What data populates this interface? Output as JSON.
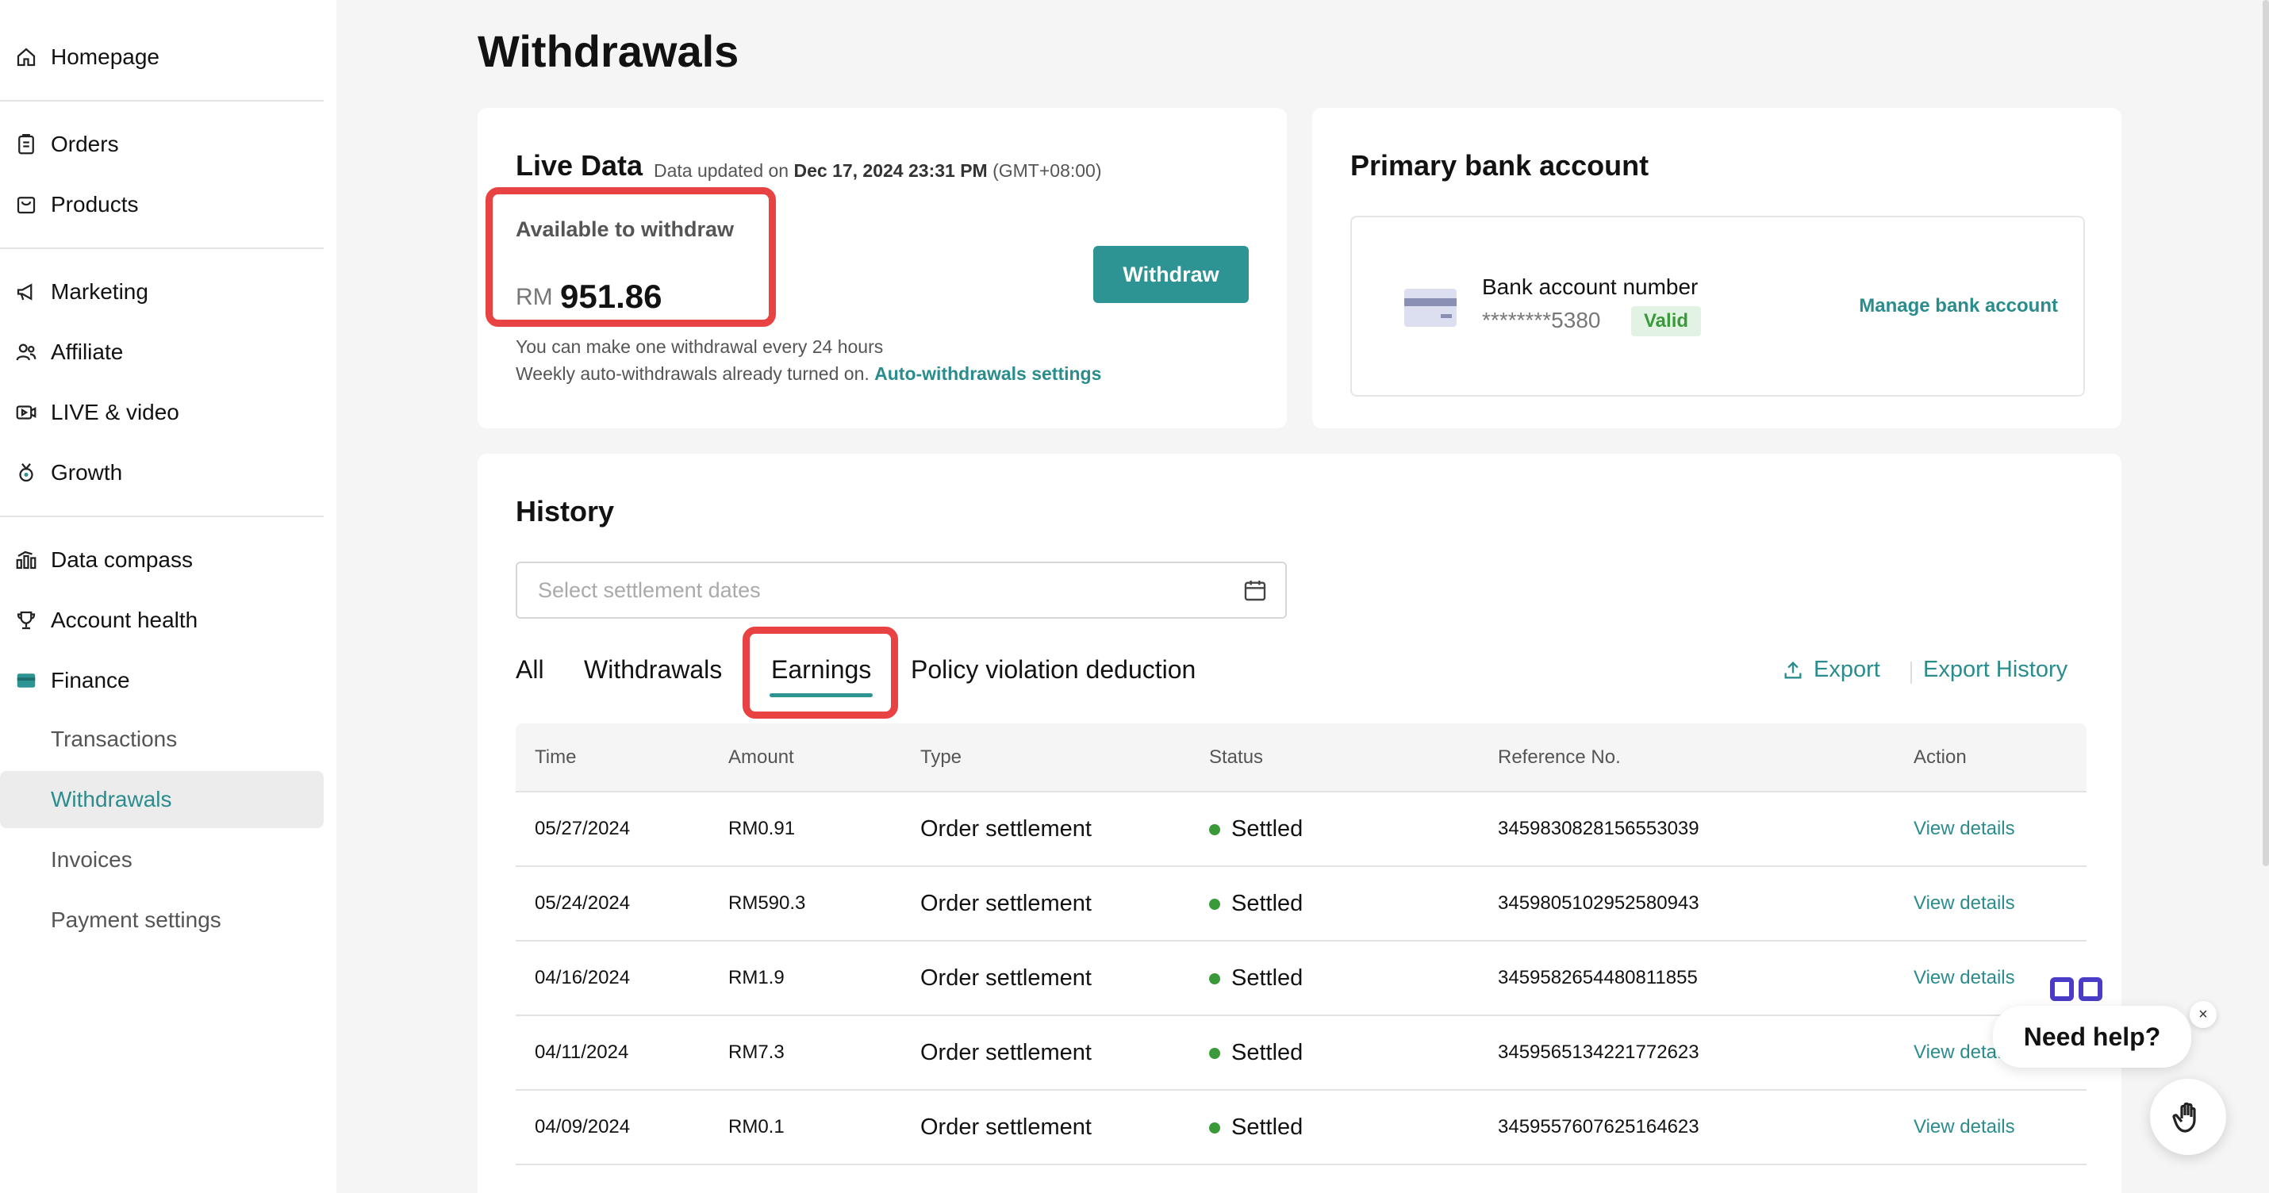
{
  "sidebar": {
    "items": [
      {
        "label": "Homepage",
        "icon": "home-icon"
      },
      {
        "label": "Orders",
        "icon": "clipboard-icon"
      },
      {
        "label": "Products",
        "icon": "bag-icon"
      },
      {
        "label": "Marketing",
        "icon": "megaphone-icon"
      },
      {
        "label": "Affiliate",
        "icon": "users-icon"
      },
      {
        "label": "LIVE & video",
        "icon": "video-icon"
      },
      {
        "label": "Growth",
        "icon": "medal-icon"
      },
      {
        "label": "Data compass",
        "icon": "bar-chart-icon"
      },
      {
        "label": "Account health",
        "icon": "trophy-icon"
      },
      {
        "label": "Finance",
        "icon": "wallet-icon"
      }
    ],
    "finance_sub": [
      {
        "label": "Transactions"
      },
      {
        "label": "Withdrawals"
      },
      {
        "label": "Invoices"
      },
      {
        "label": "Payment settings"
      }
    ]
  },
  "page": {
    "title": "Withdrawals"
  },
  "live": {
    "title": "Live Data",
    "updated_prefix": "Data updated on",
    "updated_date": "Dec 17, 2024 23:31 PM",
    "updated_tz": "(GMT+08:00)",
    "available_label": "Available to withdraw",
    "currency": "RM",
    "amount": "951.86",
    "withdraw_label": "Withdraw",
    "note1": "You can make one withdrawal every 24 hours",
    "note2": "Weekly auto-withdrawals already turned on.",
    "auto_link": "Auto-withdrawals settings"
  },
  "bank": {
    "title": "Primary bank account",
    "label": "Bank account number",
    "number": "********5380",
    "status": "Valid",
    "manage_link": "Manage bank account"
  },
  "history": {
    "title": "History",
    "date_placeholder": "Select settlement dates",
    "tabs": {
      "all": "All",
      "withdrawals": "Withdrawals",
      "earnings": "Earnings",
      "policy": "Policy violation deduction"
    },
    "export": "Export",
    "export_history": "Export History",
    "columns": [
      "Time",
      "Amount",
      "Type",
      "Status",
      "Reference No.",
      "Action"
    ],
    "rows": [
      {
        "time": "05/27/2024",
        "amount": "RM0.91",
        "type": "Order settlement",
        "status": "Settled",
        "ref": "3459830828156553039",
        "action": "View details"
      },
      {
        "time": "05/24/2024",
        "amount": "RM590.3",
        "type": "Order settlement",
        "status": "Settled",
        "ref": "3459805102952580943",
        "action": "View details"
      },
      {
        "time": "04/16/2024",
        "amount": "RM1.9",
        "type": "Order settlement",
        "status": "Settled",
        "ref": "3459582654480811855",
        "action": "View details"
      },
      {
        "time": "04/11/2024",
        "amount": "RM7.3",
        "type": "Order settlement",
        "status": "Settled",
        "ref": "3459565134221772623",
        "action": "View deta..."
      },
      {
        "time": "04/09/2024",
        "amount": "RM0.1",
        "type": "Order settlement",
        "status": "Settled",
        "ref": "3459557607625164623",
        "action": "View details"
      }
    ]
  },
  "help": {
    "label": "Need help?",
    "close": "×"
  },
  "colors": {
    "accent": "#2d9393",
    "highlight": "#e84242",
    "settled": "#3a9a3a"
  }
}
